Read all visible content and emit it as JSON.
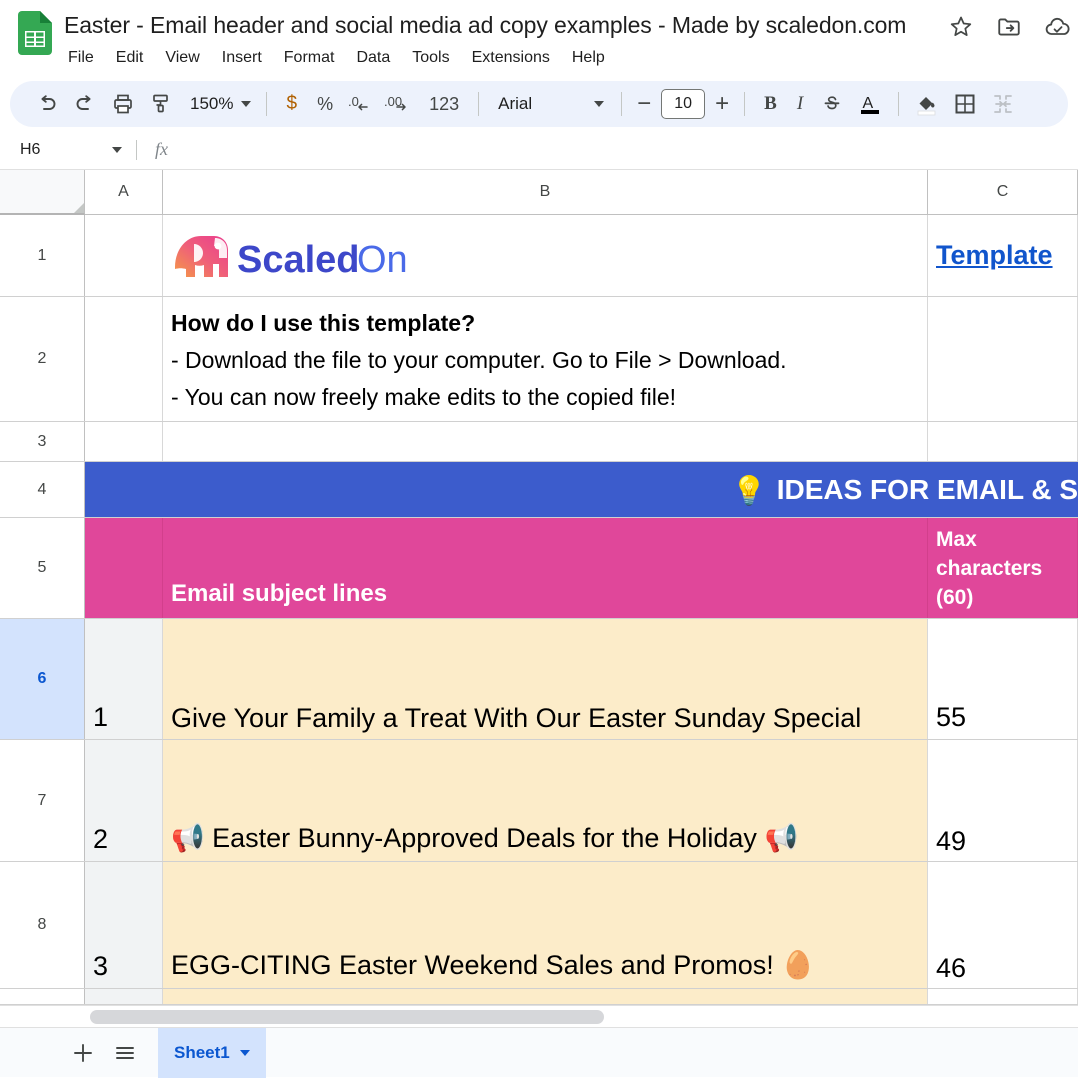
{
  "app": {
    "doc_title": "Easter - Email header and social media ad copy examples - Made by scaledon.com",
    "logo_icon": "google-sheets-icon",
    "title_icons": [
      "star-icon",
      "move-to-folder-icon",
      "cloud-saved-icon"
    ]
  },
  "menubar": {
    "items": [
      {
        "label": "File"
      },
      {
        "label": "Edit"
      },
      {
        "label": "View"
      },
      {
        "label": "Insert"
      },
      {
        "label": "Format"
      },
      {
        "label": "Data"
      },
      {
        "label": "Tools"
      },
      {
        "label": "Extensions"
      },
      {
        "label": "Help"
      }
    ]
  },
  "toolbar": {
    "undo_icon": "undo-icon",
    "redo_icon": "redo-icon",
    "print_icon": "print-icon",
    "paint_format_icon": "paint-format-icon",
    "zoom_value": "150%",
    "currency_label": "$",
    "percent_label": "%",
    "decrease_decimal_label": ".0",
    "increase_decimal_label": ".00",
    "more_formats_label": "123",
    "font_name": "Arial",
    "font_size": "10",
    "decrease_font_label": "−",
    "increase_font_label": "+",
    "bold_label": "B",
    "italic_label": "I",
    "strikethrough_icon": "strikethrough-icon",
    "text_color_label": "A",
    "fill_color_icon": "fill-color-icon",
    "borders_icon": "borders-icon",
    "merge_cells_icon": "merge-cells-icon"
  },
  "formula_bar": {
    "name_box_value": "H6",
    "fx_label": "fx",
    "formula_value": ""
  },
  "grid": {
    "columns": [
      {
        "label": "A"
      },
      {
        "label": "B"
      },
      {
        "label": "C"
      }
    ],
    "selected_row": "6",
    "rows": [
      {
        "num": "1"
      },
      {
        "num": "2"
      },
      {
        "num": "3"
      },
      {
        "num": "4"
      },
      {
        "num": "5"
      },
      {
        "num": "6"
      },
      {
        "num": "7"
      },
      {
        "num": "8"
      }
    ],
    "row1": {
      "logo_icon": "scaledon-elephant-logo",
      "logo_text_dark": "Scaled",
      "logo_text_light": "On",
      "template_link": "Template"
    },
    "row2": {
      "heading": "How do I use this template?",
      "line1": "- Download the file to your computer. Go to File > Download.",
      "line2": "- You can now freely make edits to the copied file!"
    },
    "row4": {
      "bulb_icon": "light-bulb-icon",
      "banner_text": "IDEAS FOR EMAIL & S"
    },
    "row5": {
      "col_b_header": "Email subject lines",
      "col_c_header": "Max characters (60)"
    },
    "data_rows": [
      {
        "index": "1",
        "subject": "Give Your Family a Treat With Our Easter Sunday Special",
        "max_chars": "55",
        "emoji_start": "",
        "emoji_end": ""
      },
      {
        "index": "2",
        "subject": "Easter Bunny-Approved Deals for the Holiday",
        "max_chars": "49",
        "emoji_start": "📢",
        "emoji_end": "📢"
      },
      {
        "index": "3",
        "subject": "EGG-CITING Easter Weekend Sales and Promos!",
        "max_chars": "46",
        "emoji_start": "",
        "emoji_end": "🥚"
      }
    ]
  },
  "sheetbar": {
    "add_sheet_label": "+",
    "all_sheets_icon": "all-sheets-icon",
    "tabs": [
      {
        "label": "Sheet1"
      }
    ]
  },
  "colors": {
    "banner_blue": "#3c5ccc",
    "header_pink": "#e0479a",
    "cell_cream": "#fcecc9",
    "link_blue": "#1155cc",
    "selection_blue": "#d3e3fd",
    "sheets_green": "#34a853"
  }
}
